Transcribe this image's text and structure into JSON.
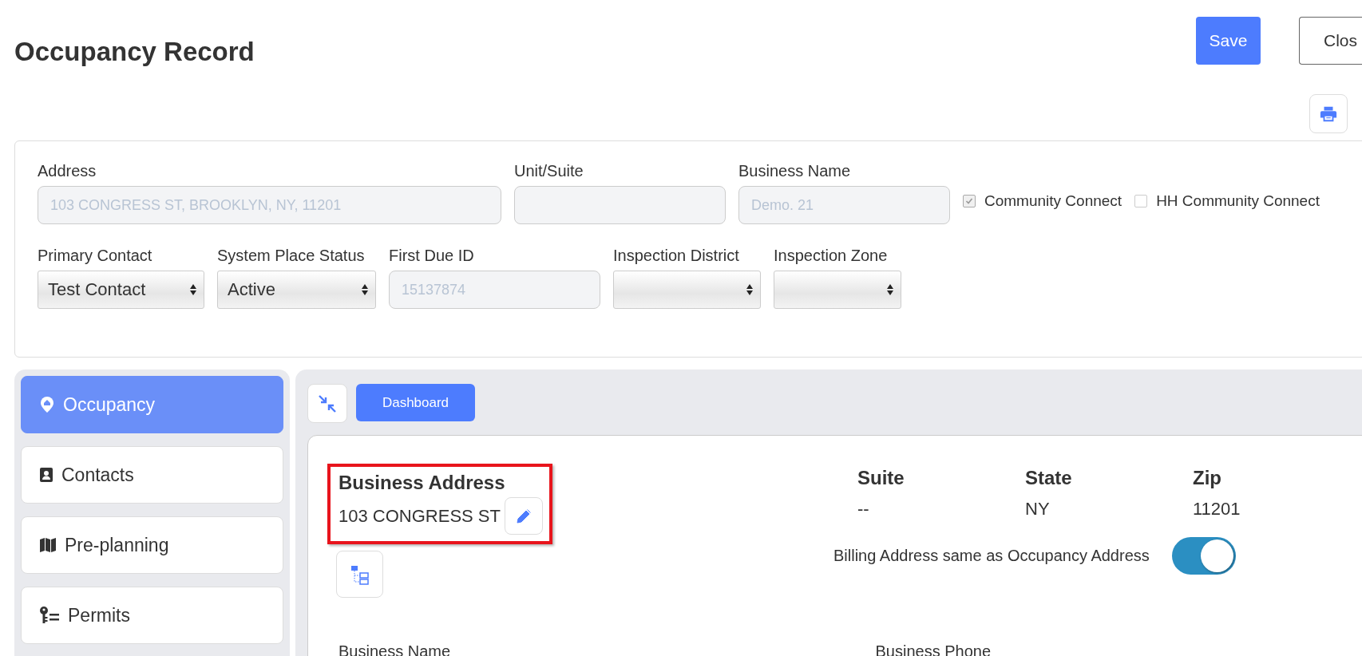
{
  "header": {
    "title": "Occupancy Record",
    "buttons": [
      {
        "label": "Save",
        "kind": "primary"
      },
      {
        "label": "Clos",
        "kind": "outline"
      }
    ]
  },
  "form": {
    "location_fields": [
      {
        "label": "Address",
        "value": "103 CONGRESS ST, BROOKLYN, NY, 11201",
        "kind": "text",
        "disabled": true
      },
      {
        "label": "Unit/Suite",
        "kind": "text",
        "disabled": true
      },
      {
        "label": "Business Name",
        "value": "Demo. 21",
        "kind": "text",
        "disabled": true
      }
    ],
    "checkboxes": [
      {
        "label": "Community Connect",
        "checked": true,
        "disabled": true
      },
      {
        "label": "HH Community Connect",
        "checked": false,
        "disabled": false
      }
    ],
    "detail_fields": [
      {
        "label": "Primary Contact",
        "value": "Test Contact",
        "kind": "select",
        "disabled": false
      },
      {
        "label": "System Place Status",
        "value": "Active",
        "kind": "select",
        "disabled": false
      },
      {
        "label": "First Due ID",
        "value": "15137874",
        "kind": "text",
        "disabled": true
      },
      {
        "label": "Inspection District",
        "kind": "select",
        "disabled": false
      },
      {
        "label": "Inspection Zone",
        "kind": "select",
        "disabled": false
      }
    ]
  },
  "sidebar": {
    "items": [
      {
        "label": "Occupancy",
        "selected": true
      },
      {
        "label": "Contacts",
        "selected": false
      },
      {
        "label": "Pre-planning",
        "selected": false
      },
      {
        "label": "Permits",
        "selected": false
      }
    ]
  },
  "panel": {
    "dashboard_button": "Dashboard",
    "address": {
      "heading": "Business Address",
      "value": "103 CONGRESS ST",
      "highlighted": true
    },
    "columns": [
      {
        "heading": "Suite",
        "value": "--"
      },
      {
        "heading": "State",
        "value": "NY"
      },
      {
        "heading": "Zip",
        "value": "11201"
      }
    ],
    "billing_toggle": {
      "label": "Billing Address same as Occupancy Address",
      "on": true
    },
    "field_labels": [
      "Business Name",
      "Business Phone"
    ]
  }
}
